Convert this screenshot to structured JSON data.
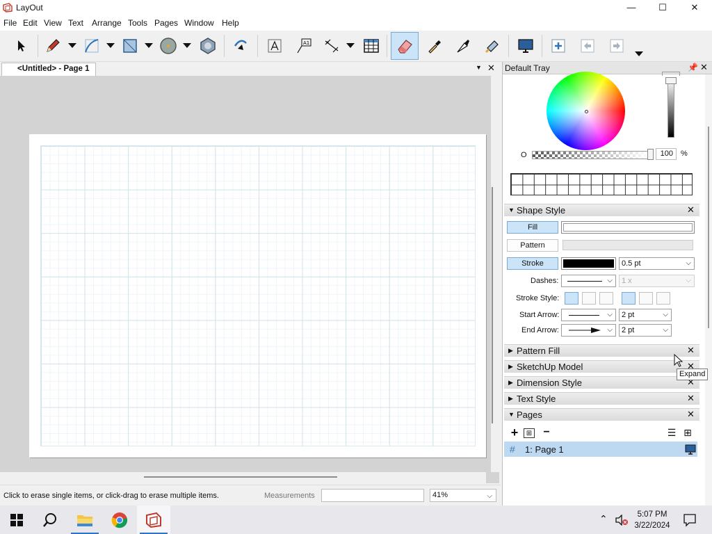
{
  "window": {
    "title": "LayOut",
    "minimize": "—",
    "maximize": "☐",
    "close": "✕"
  },
  "menu": [
    "File",
    "Edit",
    "View",
    "Text",
    "Arrange",
    "Tools",
    "Pages",
    "Window",
    "Help"
  ],
  "doc_tab": {
    "label": "<Untitled> - Page 1"
  },
  "status": {
    "hint": "Click to erase single items, or click-drag to erase multiple items.",
    "measurements_label": "Measurements",
    "measurements_value": "",
    "zoom": "41%"
  },
  "tray": {
    "title": "Default Tray",
    "colors": {
      "opacity_label": "O",
      "opacity_value": "100",
      "opacity_unit": "%"
    },
    "shape_style": {
      "title": "Shape Style",
      "fill_label": "Fill",
      "pattern_label": "Pattern",
      "stroke_label": "Stroke",
      "stroke_width": "0.5 pt",
      "dashes_label": "Dashes:",
      "dash_scale": "1 x",
      "stroke_style_label": "Stroke Style:",
      "start_arrow_label": "Start Arrow:",
      "start_arrow_size": "2 pt",
      "end_arrow_label": "End Arrow:",
      "end_arrow_size": "2 pt",
      "fill_color": "#ffffff",
      "stroke_color": "#000000"
    },
    "sections": [
      "Pattern Fill",
      "SketchUp Model",
      "Dimension Style",
      "Text Style"
    ],
    "pages": {
      "title": "Pages",
      "items": [
        {
          "label": "1:  Page 1"
        }
      ]
    }
  },
  "tooltip": "Expand",
  "taskbar": {
    "time": "5:07 PM",
    "date": "3/22/2024"
  },
  "accent": "#2f73c9"
}
